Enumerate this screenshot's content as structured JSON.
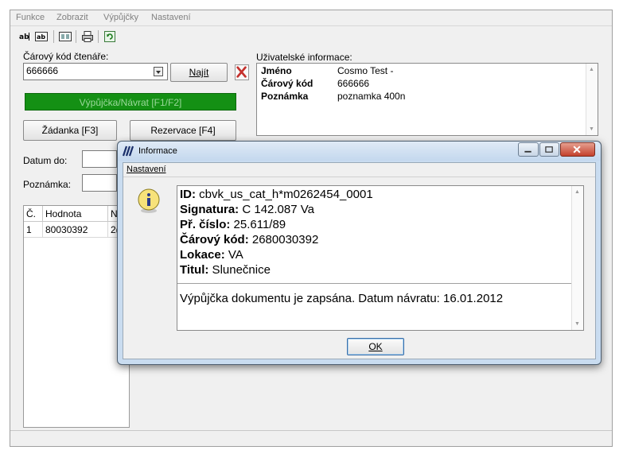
{
  "main": {
    "menu": [
      "Funkce",
      "Zobrazit",
      "Výpůjčky",
      "Nastavení"
    ],
    "reader_barcode_label": "Čárový kód čtenáře:",
    "reader_barcode_value": "666666",
    "find_button": "Najít",
    "loan_return_button": "Výpůjčka/Návrat [F1/F2]",
    "request_button": "Žádanka [F3]",
    "reservation_button": "Rezervace [F4]",
    "date_to_label": "Datum do:",
    "note_label": "Poznámka:",
    "user_info_label": "Uživatelské informace:",
    "user_info": [
      {
        "key": "Jméno",
        "value": "Cosmo Test -"
      },
      {
        "key": "Čárový kód",
        "value": "666666"
      },
      {
        "key": "Poznámka",
        "value": "poznamka 400n"
      }
    ],
    "grid": {
      "headers": [
        "Č.",
        "Hodnota",
        "N"
      ],
      "rows": [
        [
          "1",
          "80030392",
          "2("
        ]
      ]
    }
  },
  "dialog": {
    "title": "Informace",
    "menu": "Nastavení",
    "lines": [
      {
        "key": "ID:",
        "value": " cbvk_us_cat_h*m0262454_0001"
      },
      {
        "key": "Signatura:",
        "value": " C 142.087 Va"
      },
      {
        "key": "Př. číslo:",
        "value": " 25.611/89"
      },
      {
        "key": "Čárový kód:",
        "value": " 2680030392"
      },
      {
        "key": "Lokace:",
        "value": " VA"
      },
      {
        "key": "Titul:",
        "value": " Slunečnice"
      }
    ],
    "message": "Výpůjčka dokumentu je zapsána. Datum návratu: 16.01.2012",
    "ok_button": "OK"
  },
  "colors": {
    "green_bar": "#149014",
    "dialog_frame": "#c9dcf0",
    "close_red": "#c4402c"
  }
}
